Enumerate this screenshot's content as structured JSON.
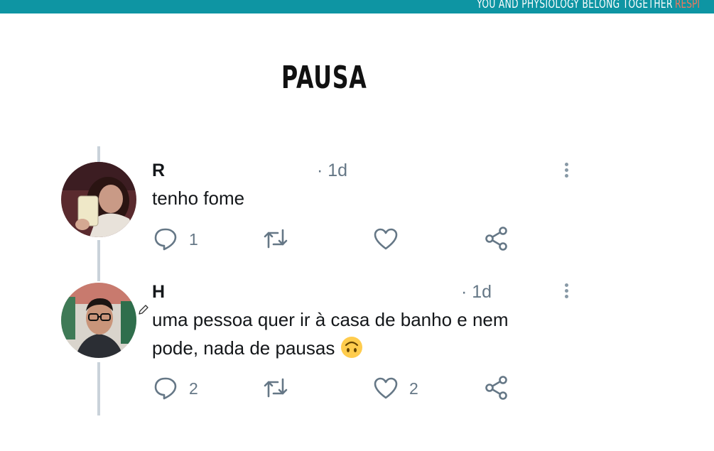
{
  "banner": {
    "text": "YOU AND PHYSIOLOGY BELONG TOGETHER",
    "accent_text": "RESPI",
    "color": "#0e95a3",
    "accent_color": "#f2775b"
  },
  "title": "PAUSA",
  "tweets": [
    {
      "username": "R",
      "time": "· 1d",
      "text": "tenho fome",
      "reply_count": "1",
      "like_count": ""
    },
    {
      "username": "H",
      "time": "· 1d",
      "text_line1": "uma pessoa quer ir à casa de banho e nem",
      "text_line2": "pode, nada de pausas",
      "emoji": "upside-down-face",
      "reply_count": "2",
      "like_count": "2"
    }
  ]
}
